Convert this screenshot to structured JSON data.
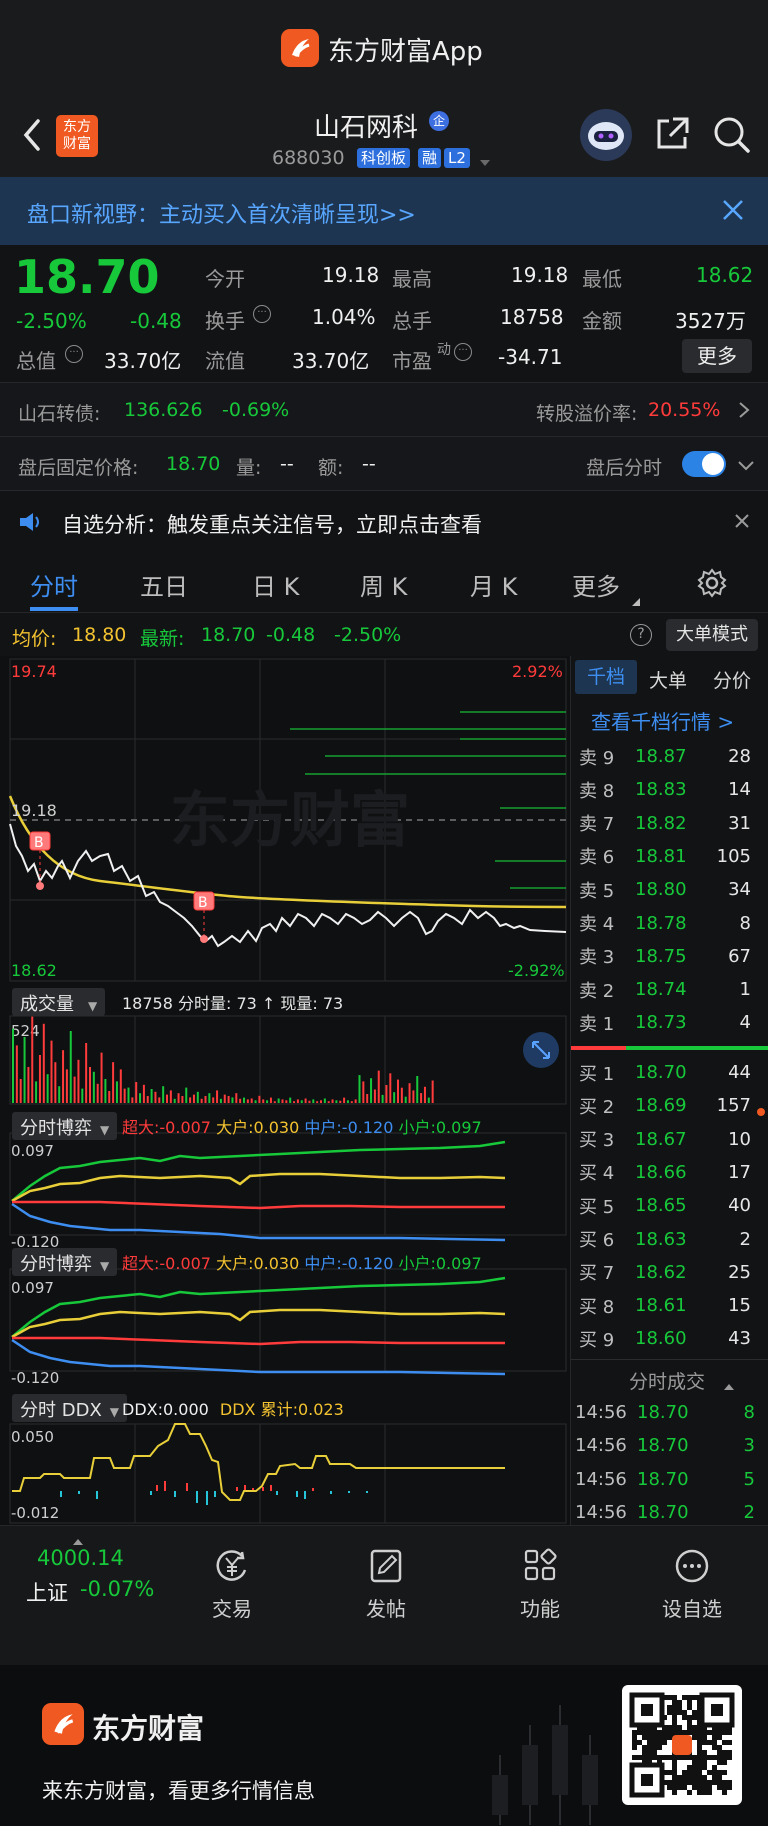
{
  "app_bar": {
    "title": "东方财富App"
  },
  "header": {
    "back_badge": "东方\n财富",
    "stock_name": "山石网科",
    "stock_tag": "企",
    "stock_code": "688030",
    "badges": [
      "科创板",
      "融",
      "L2"
    ]
  },
  "banner": {
    "text": "盘口新视野：主动买入首次清晰呈现>>"
  },
  "quote": {
    "price": "18.70",
    "change_pct": "-2.50%",
    "change": "-0.48",
    "fields": {
      "open_label": "今开",
      "open": "19.18",
      "high_label": "最高",
      "high": "19.18",
      "low_label": "最低",
      "low": "18.62",
      "turnover_label": "换手",
      "turnover": "1.04%",
      "volume_label": "总手",
      "volume": "18758",
      "amount_label": "金额",
      "amount": "3527万",
      "mktcap_label": "总值",
      "mktcap": "33.70亿",
      "float_label": "流值",
      "float": "33.70亿",
      "pe_label": "市盈",
      "pe_sup": "动",
      "pe": "-34.71",
      "more_button": "更多"
    }
  },
  "bond_row": {
    "label": "山石转债:",
    "price": "136.626",
    "pct": "-0.69%",
    "premium_label": "转股溢价率:",
    "premium": "20.55%"
  },
  "after_hours": {
    "label": "盘后固定价格:",
    "price": "18.70",
    "vol_label": "量:",
    "vol": "--",
    "amt_label": "额:",
    "amt": "--",
    "toggle_label": "盘后分时"
  },
  "notice": {
    "text": "自选分析：触发重点关注信号，立即点击查看"
  },
  "tabs": [
    "分时",
    "五日",
    "日 K",
    "周 K",
    "月 K",
    "更多"
  ],
  "chart_header": {
    "avg_label": "均价:",
    "avg": "18.80",
    "last_label": "最新:",
    "last": "18.70",
    "chg": "-0.48",
    "pct": "-2.50%",
    "mode_button": "大单模式"
  },
  "price_chart": {
    "y_high": "19.74",
    "y_low": "18.62",
    "y_mid": "19.18",
    "pct_high": "2.92%",
    "pct_low": "-2.92%",
    "watermark": "东方财富",
    "marker": "B"
  },
  "volume_panel": {
    "selector": "成交量",
    "info": "18758 分时量: 73 ↑ 现量: 73",
    "max": "524"
  },
  "game_panel_1": {
    "selector": "分时博弈",
    "legend": [
      {
        "k": "超大:",
        "v": "-0.007"
      },
      {
        "k": "大户:",
        "v": "0.030"
      },
      {
        "k": "中户:",
        "v": "-0.120"
      },
      {
        "k": "小户:",
        "v": "0.097"
      }
    ],
    "y_top": "0.097",
    "y_bottom": "-0.120"
  },
  "game_panel_2": {
    "selector": "分时博弈",
    "legend": [
      {
        "k": "超大:",
        "v": "-0.007"
      },
      {
        "k": "大户:",
        "v": "0.030"
      },
      {
        "k": "中户:",
        "v": "-0.120"
      },
      {
        "k": "小户:",
        "v": "0.097"
      }
    ],
    "y_top": "0.097",
    "y_bottom": "-0.120"
  },
  "ddx_panel": {
    "selector": "分时 DDX",
    "ddx": "DDX:0.000",
    "ddx_sum": "DDX 累计:0.023",
    "y_top": "0.050",
    "y_bottom": "-0.012"
  },
  "order_book": {
    "tabs": [
      "千档",
      "大单",
      "分价"
    ],
    "view_link": "查看千档行情 >",
    "asks": [
      {
        "l": "卖 9",
        "p": "18.87",
        "v": "28"
      },
      {
        "l": "卖 8",
        "p": "18.83",
        "v": "14"
      },
      {
        "l": "卖 7",
        "p": "18.82",
        "v": "31"
      },
      {
        "l": "卖 6",
        "p": "18.81",
        "v": "105"
      },
      {
        "l": "卖 5",
        "p": "18.80",
        "v": "34"
      },
      {
        "l": "卖 4",
        "p": "18.78",
        "v": "8"
      },
      {
        "l": "卖 3",
        "p": "18.75",
        "v": "67"
      },
      {
        "l": "卖 2",
        "p": "18.74",
        "v": "1"
      },
      {
        "l": "卖 1",
        "p": "18.73",
        "v": "4"
      }
    ],
    "bids": [
      {
        "l": "买 1",
        "p": "18.70",
        "v": "44"
      },
      {
        "l": "买 2",
        "p": "18.69",
        "v": "157"
      },
      {
        "l": "买 3",
        "p": "18.67",
        "v": "10"
      },
      {
        "l": "买 4",
        "p": "18.66",
        "v": "17"
      },
      {
        "l": "买 5",
        "p": "18.65",
        "v": "40"
      },
      {
        "l": "买 6",
        "p": "18.63",
        "v": "2"
      },
      {
        "l": "买 7",
        "p": "18.62",
        "v": "25"
      },
      {
        "l": "买 8",
        "p": "18.61",
        "v": "15"
      },
      {
        "l": "买 9",
        "p": "18.60",
        "v": "43"
      }
    ],
    "trades_title": "分时成交",
    "trades": [
      {
        "t": "14:56",
        "p": "18.70",
        "v": "8"
      },
      {
        "t": "14:56",
        "p": "18.70",
        "v": "3"
      },
      {
        "t": "14:56",
        "p": "18.70",
        "v": "5"
      },
      {
        "t": "14:56",
        "p": "18.70",
        "v": "2"
      }
    ]
  },
  "bottom_nav": {
    "index_value": "4000.14",
    "index_name": "上证",
    "index_pct": "-0.07%",
    "items": [
      "交易",
      "发帖",
      "功能",
      "设自选"
    ]
  },
  "footer": {
    "brand": "东方财富",
    "slogan": "来东方财富，看更多行情信息"
  }
}
